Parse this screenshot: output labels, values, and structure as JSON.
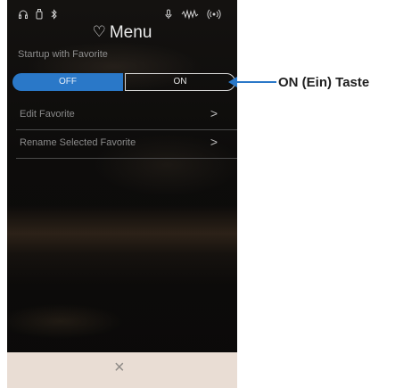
{
  "status_bar": {
    "headphone_icon": "headphone-icon",
    "usb_icon": "usb-icon",
    "bluetooth_icon": "bluetooth-icon",
    "mic_icon": "mic-icon",
    "audio_icon": "audio-meter-icon",
    "wireless_icon": "wireless-icon"
  },
  "header": {
    "heart_icon": "heart-icon",
    "title": "Menu"
  },
  "startup": {
    "label": "Startup with Favorite",
    "off_label": "OFF",
    "on_label": "ON",
    "selected": "OFF",
    "accent_color": "#2a78c8"
  },
  "menu_items": [
    {
      "label": "Edit Favorite",
      "chevron": ">"
    },
    {
      "label": "Rename Selected Favorite",
      "chevron": ">"
    }
  ],
  "bottom_bar": {
    "close_glyph": "×"
  },
  "callout": {
    "label": "ON (Ein) Taste"
  }
}
